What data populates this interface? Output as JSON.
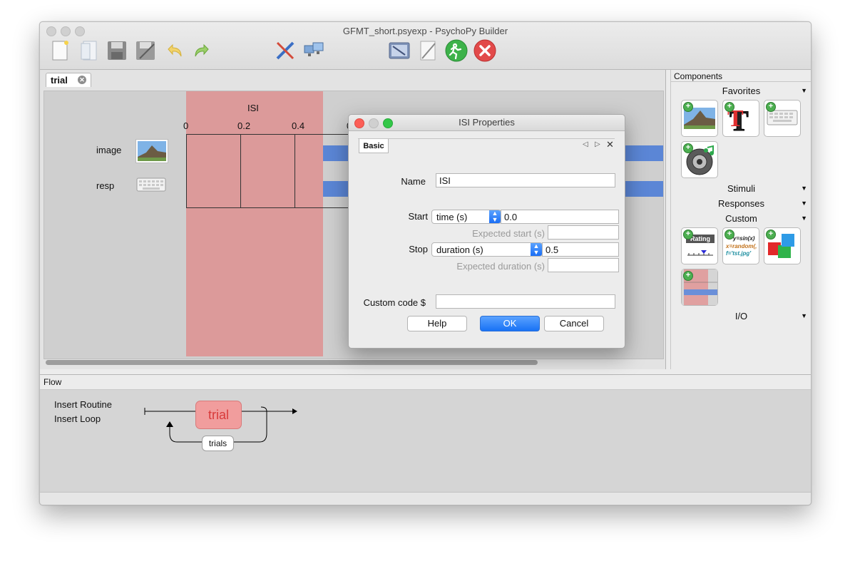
{
  "window": {
    "title": "GFMT_short.psyexp - PsychoPy Builder"
  },
  "toolbar": {
    "items": [
      "new-file-icon",
      "open-file-icon",
      "save-icon",
      "save-as-icon",
      "undo-icon",
      "redo-icon",
      "preferences-icon",
      "monitor-center-icon",
      "experiment-settings-icon",
      "compile-script-icon",
      "run-icon",
      "stop-icon"
    ]
  },
  "routine_panel": {
    "tab_label": "trial",
    "timeline": {
      "component_name": "ISI",
      "tick_labels": [
        "0",
        "0.2",
        "0.4",
        "0"
      ],
      "rows": [
        {
          "label": "image",
          "icon": "image-thumbnail-icon"
        },
        {
          "label": "resp",
          "icon": "keyboard-icon"
        }
      ]
    }
  },
  "components": {
    "header": "Components",
    "categories": {
      "favorites": "Favorites",
      "stimuli": "Stimuli",
      "responses": "Responses",
      "custom": "Custom",
      "io": "I/O"
    },
    "favorites_items": [
      "image-component-icon",
      "text-component-icon",
      "keyboard-component-icon",
      "sound-component-icon"
    ],
    "custom_items": [
      "rating-scale-icon",
      "code-component-icon",
      "aperture-icon",
      "static-component-icon"
    ],
    "rating_label": "Rating",
    "code_lines": [
      "y=sin(x)",
      "x=random(,",
      "f='tst.jpg'"
    ]
  },
  "flow": {
    "header": "Flow",
    "insert_routine": "Insert Routine",
    "insert_loop": "Insert Loop",
    "routine_label": "trial",
    "loop_label": "trials"
  },
  "dialog": {
    "title": "ISI Properties",
    "tab": "Basic",
    "name_label": "Name",
    "name_value": "ISI",
    "start_label": "Start",
    "start_type": "time (s)",
    "start_value": "0.0",
    "expected_start_label": "Expected start (s)",
    "expected_start_value": "",
    "stop_label": "Stop",
    "stop_type": "duration (s)",
    "stop_value": "0.5",
    "expected_duration_label": "Expected duration (s)",
    "expected_duration_value": "",
    "custom_code_label": "Custom code $",
    "custom_code_value": "",
    "help_label": "Help",
    "ok_label": "OK",
    "cancel_label": "Cancel"
  },
  "colors": {
    "isi_region": "#dc9a9a",
    "component_bar": "#5b86d6",
    "routine_box": "#f19d9d",
    "routine_text": "#d83a3a",
    "primary_button": "#1a73f5"
  }
}
